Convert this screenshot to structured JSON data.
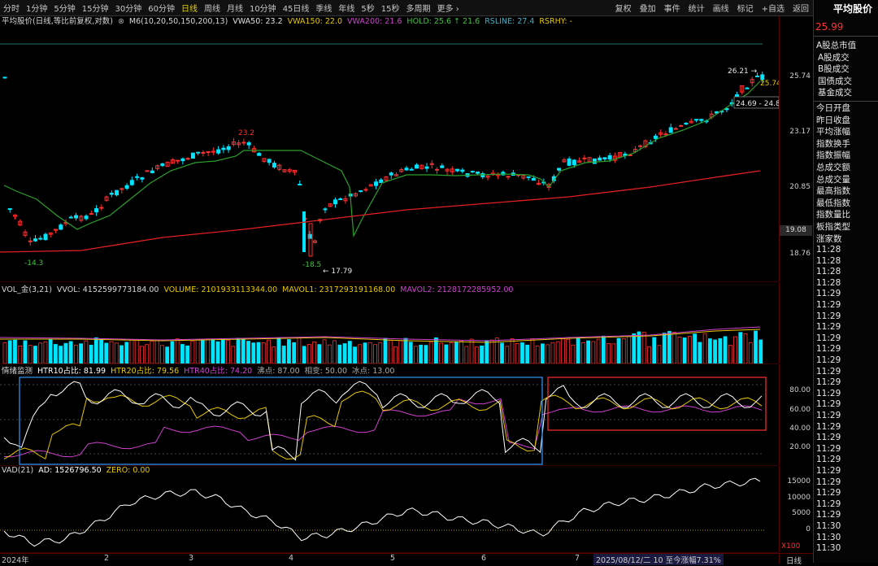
{
  "toolbar": {
    "timeframes": [
      "分时",
      "1分钟",
      "5分钟",
      "15分钟",
      "30分钟",
      "60分钟",
      "日线",
      "周线",
      "月线",
      "10分钟",
      "45日线",
      "季线",
      "年线",
      "5秒",
      "15秒",
      "多周期",
      "更多 ›"
    ],
    "active": "日线",
    "right_buttons": [
      "复权",
      "叠加",
      "事件",
      "统计",
      "画线",
      "标记",
      "+自选",
      "返回"
    ]
  },
  "sidebar": {
    "title": "平均股价",
    "price": "25.99",
    "group1_header": "A股总市值",
    "group1_items": [
      "A股成交",
      "B股成交",
      "国债成交",
      "基金成交"
    ],
    "group2_items": [
      "今日开盘",
      "昨日收盘",
      "平均涨幅",
      "指数换手",
      "指数振幅",
      "总成交额",
      "总成交量",
      "最高指数",
      "最低指数",
      "指数量比",
      "板指类型",
      "涨家数"
    ],
    "times": [
      "11:28",
      "11:28",
      "11:28",
      "11:28",
      "11:29",
      "11:29",
      "11:29",
      "11:29",
      "11:29",
      "11:29",
      "11:29",
      "11:29",
      "11:29",
      "11:29",
      "11:29",
      "11:29",
      "11:29",
      "11:29",
      "11:29",
      "11:29",
      "11:29",
      "11:29",
      "11:29",
      "11:29",
      "11:29",
      "11:30",
      "11:30",
      "11:30"
    ]
  },
  "price_panel": {
    "header": [
      {
        "t": "平均股价(日线,等比前复权,对数)",
        "c": "#d8d8d8"
      },
      {
        "t": "⊗",
        "c": "#aaaaaa"
      },
      {
        "t": "M6(10,20,50,150,200,13)",
        "c": "#d8d8d8"
      },
      {
        "t": "VWA50: 23.2",
        "c": "#e0e0e0"
      },
      {
        "t": "VWA150: 22.0",
        "c": "#e8c800"
      },
      {
        "t": "VWA200: 21.6",
        "c": "#d040d0"
      },
      {
        "t": "HOLD: 25.6 ↑ 21.6",
        "c": "#3ec43e"
      },
      {
        "t": "RSLINE: 27.4",
        "c": "#40b0c8"
      },
      {
        "t": "RSRHY: -",
        "c": "#e8c800"
      }
    ],
    "y_labels": [
      "25.74",
      "23.17",
      "20.85",
      "18.76"
    ],
    "current_price_tag": "19.08",
    "annotations": {
      "high_left": "23.2",
      "low_left": "-14.3",
      "low_mid": "-18.5",
      "low_arrow": "17.79",
      "high_right": "26.21",
      "right_a": "25.74",
      "range": "24.69 - 24.80"
    }
  },
  "volume_panel": {
    "header": [
      {
        "t": "VOL_金(3,21)",
        "c": "#d8d8d8"
      },
      {
        "t": "VVOL: 4152599773184.00",
        "c": "#d8d8d8"
      },
      {
        "t": "VOLUME: 2101933113344.00",
        "c": "#e8c800"
      },
      {
        "t": "MAVOL1: 2317293191168.00",
        "c": "#e8c800"
      },
      {
        "t": "MAVOL2: 2128172285952.00",
        "c": "#d040d0"
      }
    ]
  },
  "sentiment_panel": {
    "header": [
      {
        "t": "情绪监测",
        "c": "#d8d8d8"
      },
      {
        "t": "HTR10占比: 81.99",
        "c": "#ffffff"
      },
      {
        "t": "HTR20占比: 79.56",
        "c": "#e8c800"
      },
      {
        "t": "HTR40占比: 74.20",
        "c": "#d040d0"
      },
      {
        "t": "沸点: 87.00",
        "c": "#aaaaaa"
      },
      {
        "t": "相变: 50.00",
        "c": "#aaaaaa"
      },
      {
        "t": "冰点: 13.00",
        "c": "#aaaaaa"
      }
    ],
    "y_labels": [
      "80.00",
      "60.00",
      "40.00",
      "20.00"
    ]
  },
  "vad_panel": {
    "header": [
      {
        "t": "VAD(21)",
        "c": "#d8d8d8"
      },
      {
        "t": "AD: 1526796.50",
        "c": "#ffffff"
      },
      {
        "t": "ZERO: 0.00",
        "c": "#e8c800"
      }
    ],
    "y_labels": [
      "15000",
      "10000",
      "5000",
      "0"
    ],
    "scale": "X100"
  },
  "x_axis": {
    "labels": [
      "2024年",
      "2",
      "3",
      "4",
      "5",
      "6",
      "7"
    ],
    "status": "2025/08/12/二 10 至今涨幅7.31%",
    "period": "日线"
  },
  "colors": {
    "up": "#ff3030",
    "down": "#00ffff",
    "ma_red": "#e02020",
    "hold_green": "#2aa02a"
  }
}
